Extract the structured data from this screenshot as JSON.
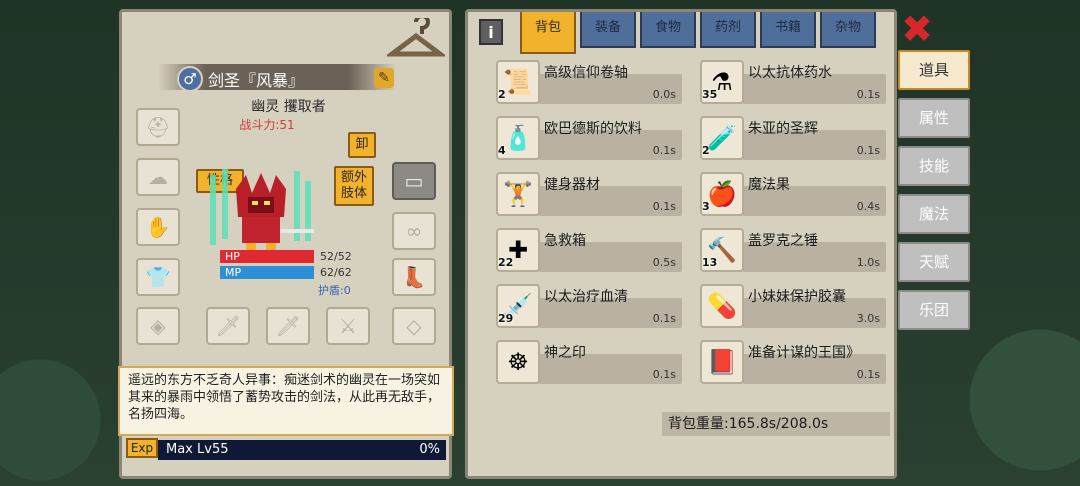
{
  "hero": {
    "name": "剑圣『风暴』",
    "gender_symbol": "♂",
    "title": "幽灵 攫取者",
    "power": "战斗力:51",
    "unequip": "卸",
    "personality": "性格",
    "extra_limb": "额外\n肢体",
    "hp_label": "HP",
    "hp_value": "52/52",
    "mp_label": "MP",
    "mp_value": "62/62",
    "shield": "护盾:0",
    "story": "遥远的东方不乏奇人异事：痴迷剑术的幽灵在一场突如其来的暴雨中领悟了蓄势攻击的剑法，从此再无敌手，名扬四海。",
    "exp_icon": "Exp",
    "level": "Max Lv55",
    "exp_percent": "0%"
  },
  "tabs": [
    "背包",
    "装备",
    "食物",
    "药剂",
    "书籍",
    "杂物"
  ],
  "info_label": "i",
  "items": [
    {
      "name": "高级信仰卷轴",
      "count": "2",
      "time": "0.0s",
      "icon": "scroll-icon",
      "glyph": "📜"
    },
    {
      "name": "以太抗体药水",
      "count": "35",
      "time": "0.1s",
      "icon": "potion-icon",
      "glyph": "⚗"
    },
    {
      "name": "欧巴德斯的饮料",
      "count": "4",
      "time": "0.1s",
      "icon": "bottle-icon",
      "glyph": "🧴"
    },
    {
      "name": "朱亚的圣辉",
      "count": "2",
      "time": "0.1s",
      "icon": "flask-icon",
      "glyph": "🧪"
    },
    {
      "name": "健身器材",
      "count": "",
      "time": "0.1s",
      "icon": "dumbbell-icon",
      "glyph": "🏋"
    },
    {
      "name": "魔法果",
      "count": "3",
      "time": "0.4s",
      "icon": "fruit-icon",
      "glyph": "🍎"
    },
    {
      "name": "急救箱",
      "count": "22",
      "time": "0.5s",
      "icon": "first-aid-icon",
      "glyph": "✚"
    },
    {
      "name": "盖罗克之锤",
      "count": "13",
      "time": "1.0s",
      "icon": "hammer-icon",
      "glyph": "🔨"
    },
    {
      "name": "以太治疗血清",
      "count": "29",
      "time": "0.1s",
      "icon": "syringe-icon",
      "glyph": "💉"
    },
    {
      "name": "小妹妹保护胶囊",
      "count": "",
      "time": "3.0s",
      "icon": "capsule-icon",
      "glyph": "💊"
    },
    {
      "name": "神之印",
      "count": "",
      "time": "0.1s",
      "icon": "seal-icon",
      "glyph": "☸"
    },
    {
      "name": "准备计谋的王国》",
      "count": "",
      "time": "0.1s",
      "icon": "book-icon",
      "glyph": "📕"
    }
  ],
  "weight": "背包重量:165.8s/208.0s",
  "side_tabs": [
    "道具",
    "属性",
    "技能",
    "魔法",
    "天赋",
    "乐团"
  ],
  "close_glyph": "✖"
}
